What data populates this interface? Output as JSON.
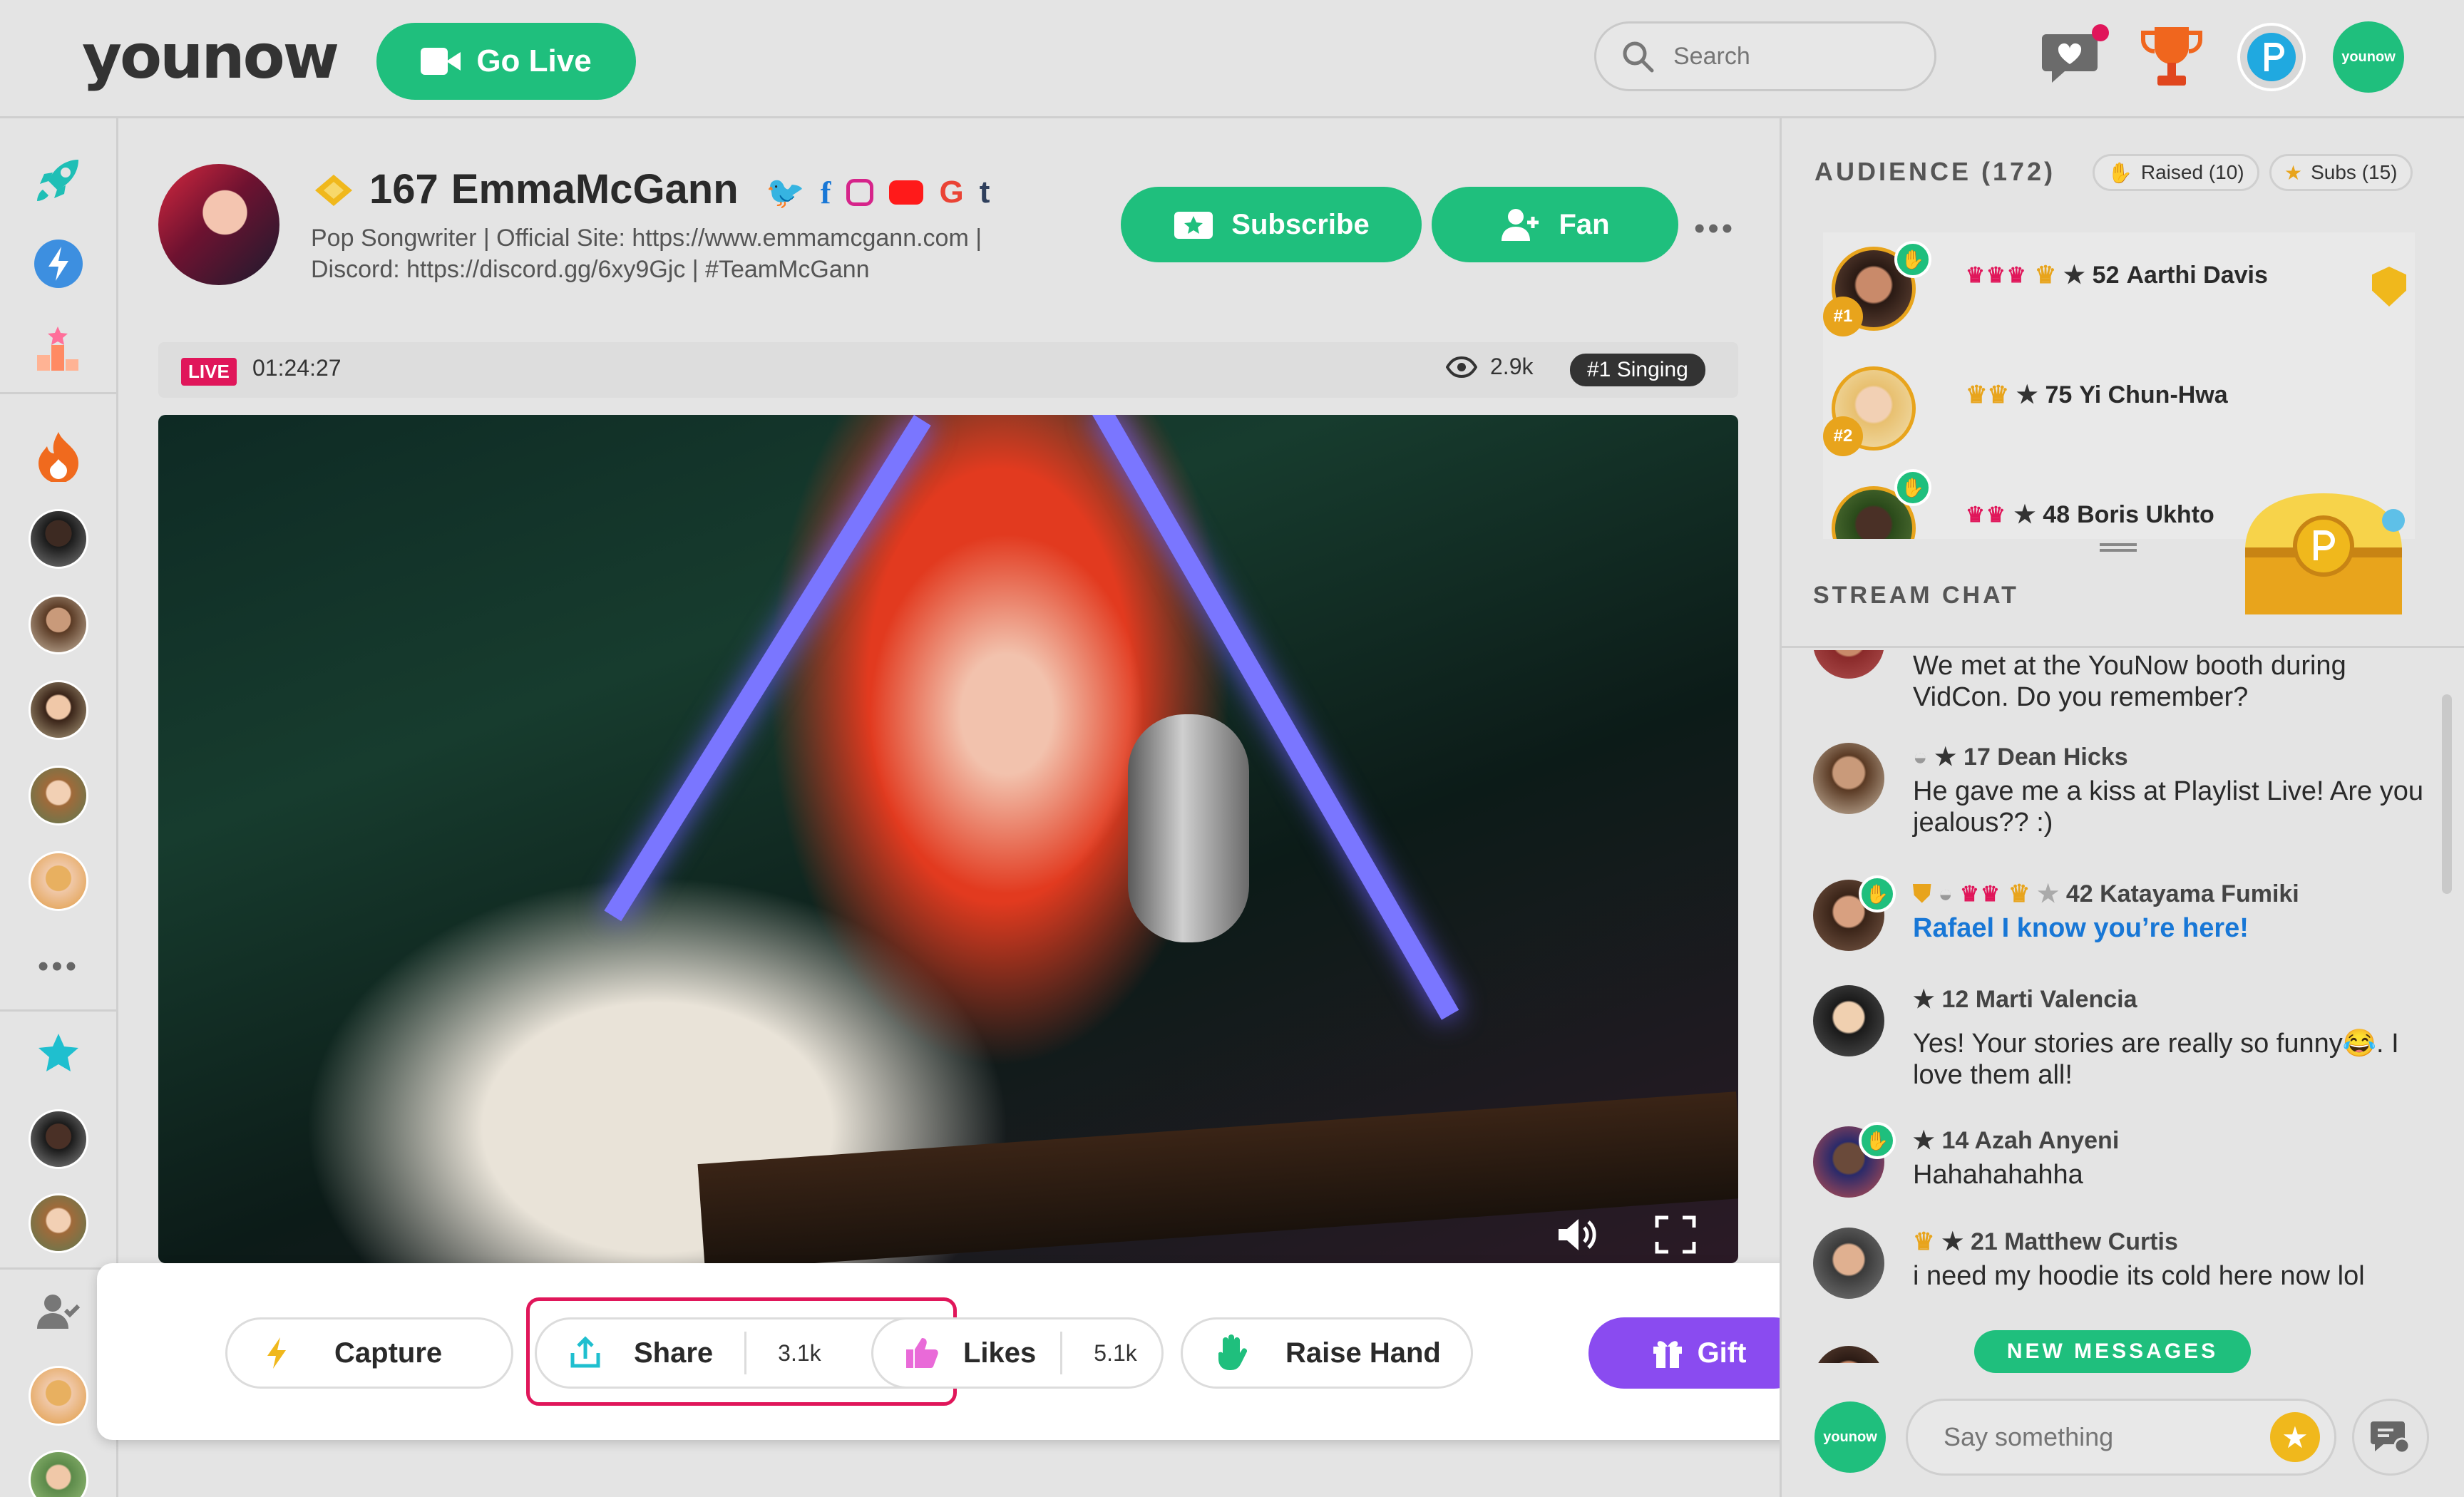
{
  "header": {
    "logo": "younow",
    "go_live": "Go Live",
    "search_placeholder": "Search",
    "profile_badge": "younow"
  },
  "broadcaster": {
    "level": "167",
    "name": "EmmaMcGann",
    "description": "Pop Songwriter | Official Site: https://www.emmamcgann.com | Discord: https://discord.gg/6xy9Gjc | #TeamMcGann",
    "socials": [
      "twitter-icon",
      "facebook-icon",
      "instagram-icon",
      "youtube-icon",
      "google-icon",
      "tumblr-icon"
    ],
    "subscribe_label": "Subscribe",
    "fan_label": "Fan"
  },
  "stream": {
    "live_label": "LIVE",
    "duration": "01:24:27",
    "viewers": "2.9k",
    "tag": "#1 Singing"
  },
  "actions": {
    "capture": "Capture",
    "share": "Share",
    "share_count": "3.1k",
    "likes": "Likes",
    "likes_count": "5.1k",
    "raise_hand": "Raise Hand",
    "gift": "Gift"
  },
  "audience": {
    "title": "AUDIENCE (172)",
    "raised": "Raised (10)",
    "subs": "Subs (15)",
    "members": [
      {
        "rank": "#1",
        "level": "52",
        "name": "Aarthi Davis"
      },
      {
        "rank": "#2",
        "level": "75",
        "name": "Yi Chun-Hwa"
      },
      {
        "rank": "",
        "level": "48",
        "name": "Boris Ukhto"
      }
    ]
  },
  "chat": {
    "title": "STREAM CHAT",
    "messages": [
      {
        "header": "",
        "text": "We met at the YouNow booth during VidCon. Do you remember?"
      },
      {
        "header": "17 Dean Hicks",
        "text": "He gave me a kiss at Playlist Live! Are you jealous?? :)"
      },
      {
        "header": "42 Katayama Fumiki",
        "text": "Rafael I know you’re here!"
      },
      {
        "header": "12 Marti Valencia",
        "text": "Yes! Your stories are really so funny😂. I love them all!"
      },
      {
        "header": "14 Azah Anyeni",
        "text": "Hahahahahha"
      },
      {
        "header": "21 Matthew Curtis",
        "text": "i need my hoodie its cold here now lol"
      }
    ],
    "new_messages": "NEW MESSAGES",
    "composer_placeholder": "Say something",
    "composer_badge": "younow"
  },
  "colors": {
    "brand_green": "#1fbf7d",
    "live_pink": "#e0165a",
    "gift_purple": "#8a4bf0",
    "gold": "#e8a41c",
    "link_blue": "#1877d6"
  }
}
